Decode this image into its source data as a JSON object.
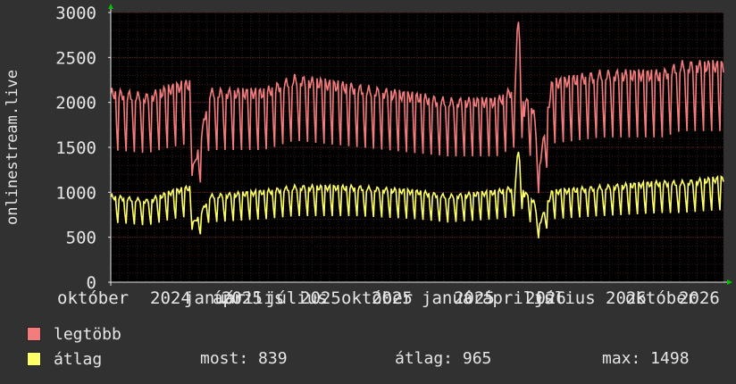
{
  "chart_data": {
    "type": "line",
    "title": "",
    "ylabel": "onlinestream.live",
    "xlabel": "",
    "ylim": [
      0,
      3000
    ],
    "yticks": [
      0,
      500,
      1000,
      1500,
      2000,
      2500,
      3000
    ],
    "xtick_labels": [
      "október",
      "2024",
      "január",
      "április",
      "2025",
      "július",
      "2025",
      "október",
      "2025",
      "január",
      "2025",
      "április",
      "2026",
      "július",
      "2026",
      "október",
      "2026"
    ],
    "grid": true,
    "background": "#000000",
    "series": [
      {
        "name": "legtöbb",
        "color": "#f47c7c",
        "pattern": "weekly",
        "baseline": [
          [
            0,
            2100
          ],
          [
            0.06,
            2050
          ],
          [
            0.1,
            2150
          ],
          [
            0.13,
            2200
          ],
          [
            0.135,
            1250
          ],
          [
            0.15,
            1700
          ],
          [
            0.16,
            2100
          ],
          [
            0.25,
            2100
          ],
          [
            0.3,
            2250
          ],
          [
            0.4,
            2150
          ],
          [
            0.5,
            2050
          ],
          [
            0.55,
            2000
          ],
          [
            0.63,
            2000
          ],
          [
            0.66,
            2150
          ],
          [
            0.665,
            3000
          ],
          [
            0.675,
            1850
          ],
          [
            0.68,
            2100
          ],
          [
            0.69,
            1900
          ],
          [
            0.7,
            1300
          ],
          [
            0.72,
            2200
          ],
          [
            0.8,
            2300
          ],
          [
            0.9,
            2300
          ],
          [
            0.93,
            2400
          ],
          [
            1.0,
            2400
          ]
        ]
      },
      {
        "name": "átlag",
        "color": "#ffff66",
        "pattern": "weekly",
        "baseline": [
          [
            0,
            950
          ],
          [
            0.06,
            900
          ],
          [
            0.1,
            1000
          ],
          [
            0.13,
            1050
          ],
          [
            0.135,
            650
          ],
          [
            0.15,
            800
          ],
          [
            0.16,
            950
          ],
          [
            0.25,
            1000
          ],
          [
            0.3,
            1050
          ],
          [
            0.4,
            1050
          ],
          [
            0.5,
            1000
          ],
          [
            0.55,
            950
          ],
          [
            0.63,
            1000
          ],
          [
            0.66,
            1050
          ],
          [
            0.665,
            1500
          ],
          [
            0.675,
            950
          ],
          [
            0.68,
            1000
          ],
          [
            0.69,
            900
          ],
          [
            0.7,
            650
          ],
          [
            0.72,
            1000
          ],
          [
            0.8,
            1050
          ],
          [
            0.9,
            1100
          ],
          [
            0.93,
            1100
          ],
          [
            1.0,
            1150
          ]
        ]
      }
    ]
  },
  "legend": {
    "max_label": "legtöbb",
    "avg_label": "átlag",
    "most": "most: 839",
    "atlag": "átlag: 965",
    "max": "max: 1498"
  },
  "colors": {
    "background": "#313131",
    "plot_bg": "#000000",
    "text": "#e6e6e6",
    "grid": "#5a1f1f",
    "max_series": "#f47c7c",
    "avg_series": "#ffff66",
    "axis_arrow": "#00c000"
  }
}
